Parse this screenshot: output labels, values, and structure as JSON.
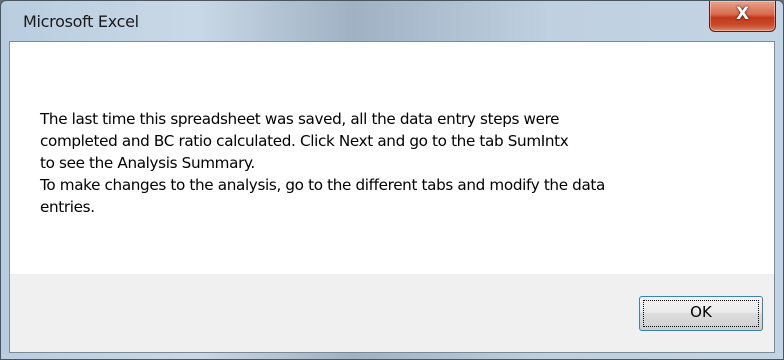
{
  "window": {
    "title": "Microsoft Excel",
    "close_label": "X"
  },
  "message": {
    "lines": [
      "The last time this spreadsheet was saved, all the data entry steps were",
      "completed and BC ratio calculated. Click Next and go to the tab SumIntx",
      "to see the Analysis Summary.",
      "To make changes to the analysis, go to the different tabs and modify the data",
      "entries."
    ]
  },
  "buttons": {
    "ok_label": "OK"
  },
  "icons": {
    "close": "close-icon"
  },
  "colors": {
    "close_button": "#c94a2c",
    "button_focus_border": "#3c7fb1",
    "message_background": "#ffffff",
    "footer_background": "#f0f0f0"
  }
}
